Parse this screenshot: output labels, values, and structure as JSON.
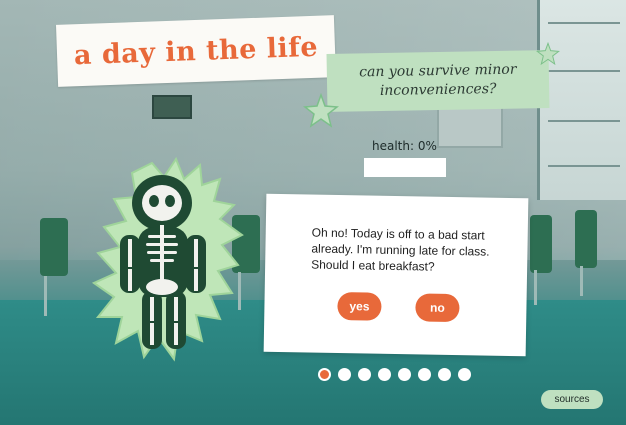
{
  "title": "a day in the life",
  "subtitle": "can you survive minor inconveniences?",
  "health": {
    "label": "health: 0%",
    "value_percent": 0
  },
  "character": {
    "icon": "skeleton-icon"
  },
  "dialog": {
    "text": "Oh no! Today is off to a bad start already. I'm running late for class. Should I eat breakfast?",
    "choices": {
      "yes": "yes",
      "no": "no"
    }
  },
  "progress": {
    "total_steps": 8,
    "current_step": 1
  },
  "sources_label": "sources",
  "colors": {
    "accent": "#e8693a",
    "mint": "#bfe0c0",
    "card": "#ffffff"
  }
}
